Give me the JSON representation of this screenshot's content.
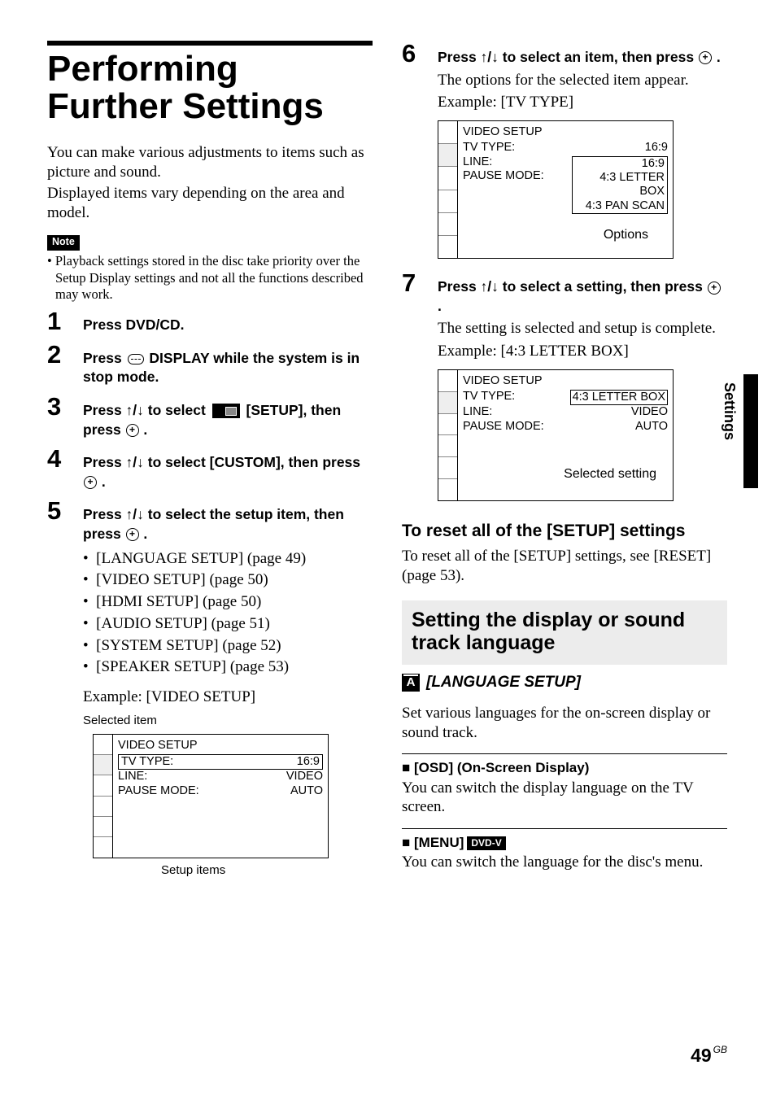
{
  "sideTab": "Settings",
  "pageNumber": "49",
  "pageRegion": "GB",
  "left": {
    "title": "Performing Further Settings",
    "intro1": "You can make various adjustments to items such as picture and sound.",
    "intro2": "Displayed items vary depending on the area and model.",
    "noteLabel": "Note",
    "noteBody": "• Playback settings stored in the disc take priority over the Setup Display settings and not all the functions described may work.",
    "step1": "Press DVD/CD.",
    "step2a": "Press ",
    "step2b": " DISPLAY while the system is in stop mode.",
    "step3a": "Press ↑/↓ to select ",
    "step3b": " [SETUP], then press ",
    "step3c": " .",
    "step4a": "Press ↑/↓ to select [CUSTOM], then press ",
    "step4b": " .",
    "step5a": "Press ↑/↓ to select the setup item, then press ",
    "step5b": " .",
    "sub1": "[LANGUAGE SETUP] (page 49)",
    "sub2": "[VIDEO SETUP] (page 50)",
    "sub3": "[HDMI SETUP] (page 50)",
    "sub4": "[AUDIO SETUP] (page 51)",
    "sub5": "[SYSTEM SETUP] (page 52)",
    "sub6": "[SPEAKER SETUP] (page 53)",
    "example5": "Example: [VIDEO SETUP]",
    "selectedItemLabel": "Selected item",
    "setupItemsLabel": "Setup items",
    "osd1": {
      "hdr": "VIDEO SETUP",
      "r1k": "TV TYPE:",
      "r1v": "16:9",
      "r2k": "LINE:",
      "r2v": "VIDEO",
      "r3k": "PAUSE MODE:",
      "r3v": "AUTO"
    }
  },
  "right": {
    "step6a": "Press ↑/↓ to select an item, then press ",
    "step6b": " .",
    "step6desc1": "The options for the selected item appear.",
    "step6desc2": "Example: [TV TYPE]",
    "osd2": {
      "hdr": "VIDEO SETUP",
      "r1k": "TV TYPE:",
      "r1v": "16:9",
      "r2k": "LINE:",
      "r3k": "PAUSE MODE:",
      "opt1": "16:9",
      "opt2": "4:3 LETTER BOX",
      "opt3": "4:3 PAN SCAN",
      "optionsLabel": "Options"
    },
    "step7a": "Press ↑/↓ to select a setting, then press ",
    "step7b": " .",
    "step7desc1": "The setting is selected and setup is complete.",
    "step7desc2": "Example: [4:3 LETTER BOX]",
    "osd3": {
      "hdr": "VIDEO SETUP",
      "r1k": "TV TYPE:",
      "r1v": "4:3 LETTER BOX",
      "r2k": "LINE:",
      "r2v": "VIDEO",
      "r3k": "PAUSE MODE:",
      "r3v": "AUTO",
      "selLabel": "Selected setting"
    },
    "resetHeading": "To reset all of the [SETUP] settings",
    "resetBody": "To reset all of the [SETUP] settings, see [RESET] (page 53).",
    "panelTitle": "Setting the display or sound track language",
    "langIconLetter": "A",
    "langTitle": "[LANGUAGE SETUP]",
    "langBody": "Set various languages for the on-screen display or sound track.",
    "osdItemTitle": "[OSD] (On-Screen Display)",
    "osdItemBody": "You can switch the display language on the TV screen.",
    "menuItemTitle": "[MENU]",
    "menuItemTag": "DVD-V",
    "menuItemBody": "You can switch the language for the disc's menu."
  }
}
